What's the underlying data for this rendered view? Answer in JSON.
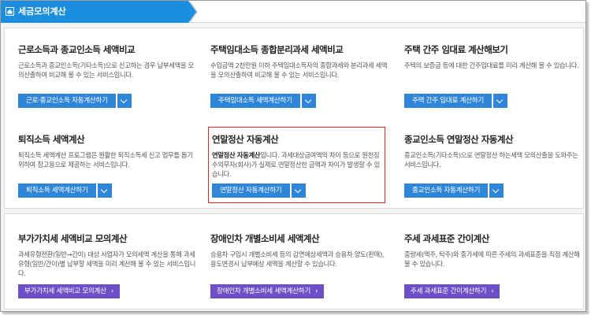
{
  "header": {
    "title": "세금모의계산"
  },
  "cards": [
    {
      "title": "근로소득과 종교인소득 세액비교",
      "desc": "근로소득과 종교인소득(기타소득)으로 신고하는 경우 납부세액을 모의산출하여 비교해 볼 수 있는 서비스입니다.",
      "button": "근로·종교인소득 자동계산하기"
    },
    {
      "title": "주택임대소득 종합분리과세 세액비교",
      "desc": "수입금액 2천만원 이하 주택임대소득자의 종합과세와 분리과세 세액을 모의산출하여 비교해 볼 수 있는 서비스입니다.",
      "button": "주택임대소득 세액계산하기"
    },
    {
      "title": "주택 간주 임대료 계산해보기",
      "desc": "주택의 보증금 등에 대한 간주임대료를 미리 계산해 볼 수 있습니다.",
      "button": "주택 간주 임대료 계산하기"
    },
    {
      "title": "퇴직소득 세액계산",
      "desc": "퇴직소득 세액계산 프로그램은 원활한 퇴직소득세 신고 업무를 돕기 위하여 참고용으로 제공하는 서비스입니다.",
      "button": "퇴직소득 세액계산하기"
    },
    {
      "title": "연말정산 자동계산",
      "desc_bold": "연말정산 자동계산",
      "desc": "입니다. 과세대상급여액의 차이 등으로 원천징수의무자(회사)가 실제로 연말정산한 금액과 차이가 발생할 수 있습니다.",
      "button": "연말정산 자동계산하기"
    },
    {
      "title": "종교인소득 연말정산 자동계산",
      "desc": "종교인소득(기타소득)으로 연말정산 하는세액 모의산출을 도와주는 서비스입니다.",
      "button": "종교인소득 자동계산하기"
    },
    {
      "title": "부가가치세 세액비교 모의계산",
      "desc": "과세유형전환(일반→간이) 대상 사업자가 모의세액 계산을 통해 과세유형(일반/간이)별 납부할 세액을 미리 계산해 볼 수 있는 서비스입니다.",
      "button": "부가가치세 세액비교 모의계산"
    },
    {
      "title": "장애인차 개별소비세 세액계산",
      "desc": "승용차 구입시 개별소비세 등의 감면예상세액과 승용차 양도(판매), 용도변경시 납부예상 세액을 계산할 수 있습니다.",
      "button": "장애인차 개별소비세 세액계산하기"
    },
    {
      "title": "주세 과세표준 간이계산",
      "desc": "종량세(맥주, 탁주)와 종가세에 따른 주세의 과세표준을 직접 계산해 볼 수 있습니다.",
      "button": "주세 과세표준 간이계산하기"
    }
  ]
}
